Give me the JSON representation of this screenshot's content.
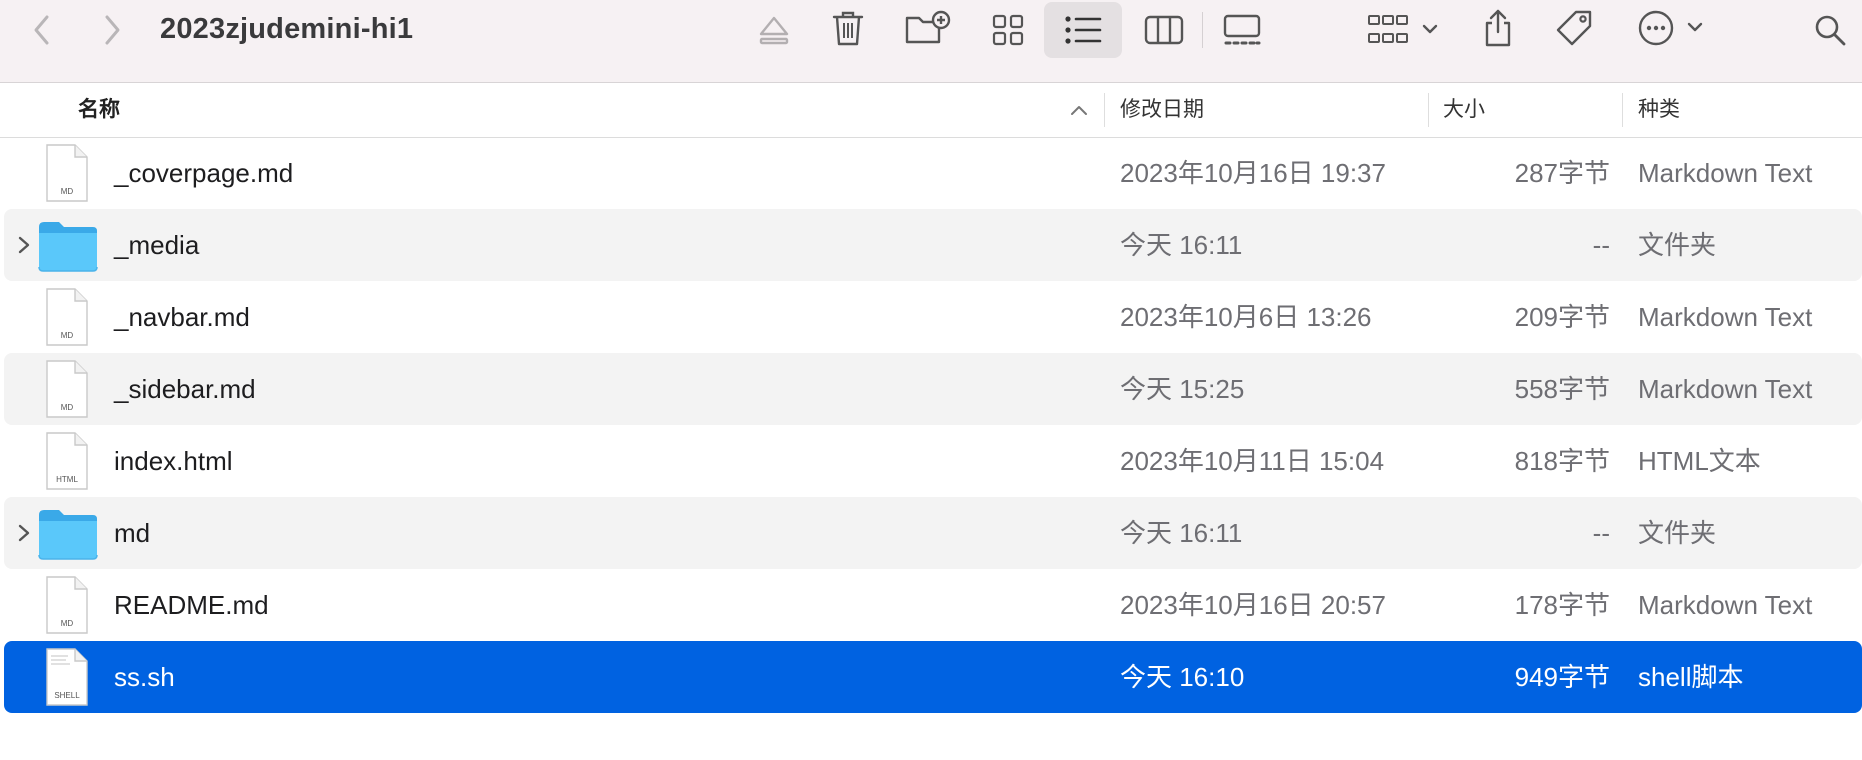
{
  "window": {
    "title": "2023zjudemini-hi1"
  },
  "toolbar": {
    "back_icon": "chevron-left-icon",
    "forward_icon": "chevron-right-icon",
    "active_view": "list"
  },
  "columns": {
    "name": "名称",
    "date": "修改日期",
    "size": "大小",
    "kind": "种类"
  },
  "files": [
    {
      "name": "_coverpage.md",
      "date": "2023年10月16日 19:37",
      "size": "287字节",
      "kind": "Markdown Text",
      "icon": "markdown-file-icon",
      "badge": "MD"
    },
    {
      "name": "_media",
      "date": "今天 16:11",
      "size": "--",
      "kind": "文件夹",
      "icon": "folder-icon",
      "badge": ""
    },
    {
      "name": "_navbar.md",
      "date": "2023年10月6日 13:26",
      "size": "209字节",
      "kind": "Markdown Text",
      "icon": "markdown-file-icon",
      "badge": "MD"
    },
    {
      "name": "_sidebar.md",
      "date": "今天 15:25",
      "size": "558字节",
      "kind": "Markdown Text",
      "icon": "markdown-file-icon",
      "badge": "MD"
    },
    {
      "name": "index.html",
      "date": "2023年10月11日 15:04",
      "size": "818字节",
      "kind": "HTML文本",
      "icon": "html-file-icon",
      "badge": "HTML"
    },
    {
      "name": "md",
      "date": "今天 16:11",
      "size": "--",
      "kind": "文件夹",
      "icon": "folder-icon",
      "badge": ""
    },
    {
      "name": "README.md",
      "date": "2023年10月16日 20:57",
      "size": "178字节",
      "kind": "Markdown Text",
      "icon": "markdown-file-icon",
      "badge": "MD"
    },
    {
      "name": "ss.sh",
      "date": "今天 16:10",
      "size": "949字节",
      "kind": "shell脚本",
      "icon": "shell-file-icon",
      "badge": "SHELL"
    }
  ],
  "selected_row": 7,
  "colors": {
    "selection": "#0062e1",
    "folder": "#5ac8fa",
    "toolbar_bg": "#f6f1f3"
  }
}
